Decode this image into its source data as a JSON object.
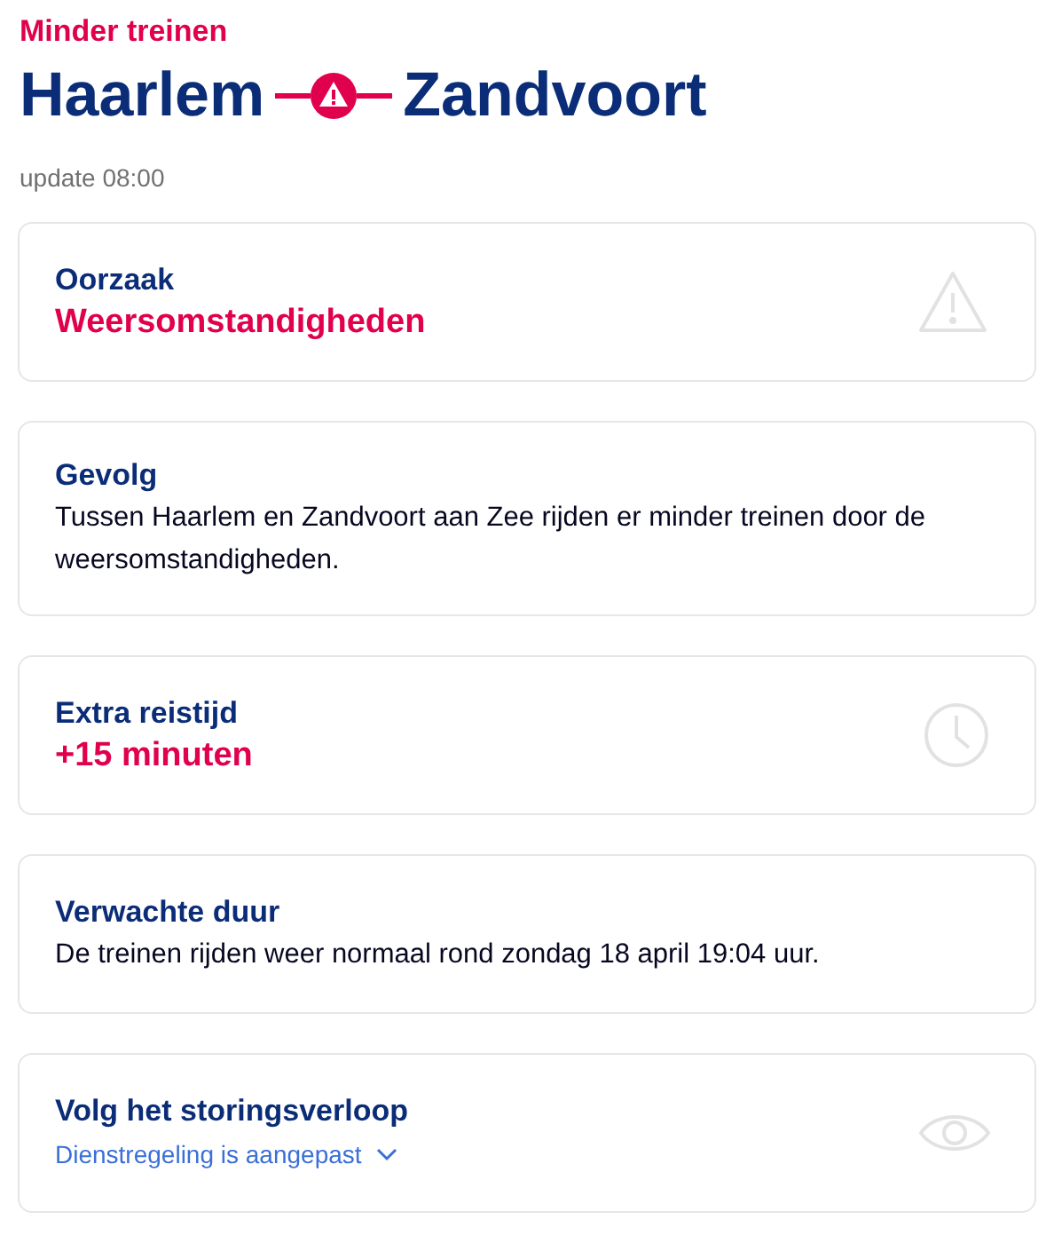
{
  "header": {
    "status": "Minder treinen",
    "from": "Haarlem",
    "to": "Zandvoort",
    "update": "update 08:00"
  },
  "cards": [
    {
      "kind": "cause",
      "title": "Oorzaak",
      "value": "Weersomstandigheden"
    },
    {
      "kind": "consequence",
      "title": "Gevolg",
      "value": "Tussen Haarlem en Zandvoort aan Zee rijden er minder treinen door de weersomstandigheden."
    },
    {
      "kind": "delay",
      "title": "Extra reistijd",
      "value": "+15 minuten"
    },
    {
      "kind": "duration",
      "title": "Verwachte duur",
      "value": "De treinen rijden weer normaal rond zondag 18 april 19:04 uur."
    },
    {
      "kind": "follow",
      "title": "Volg het storingsverloop",
      "link": "Dienstregeling is aangepast",
      "expanded": false
    }
  ]
}
